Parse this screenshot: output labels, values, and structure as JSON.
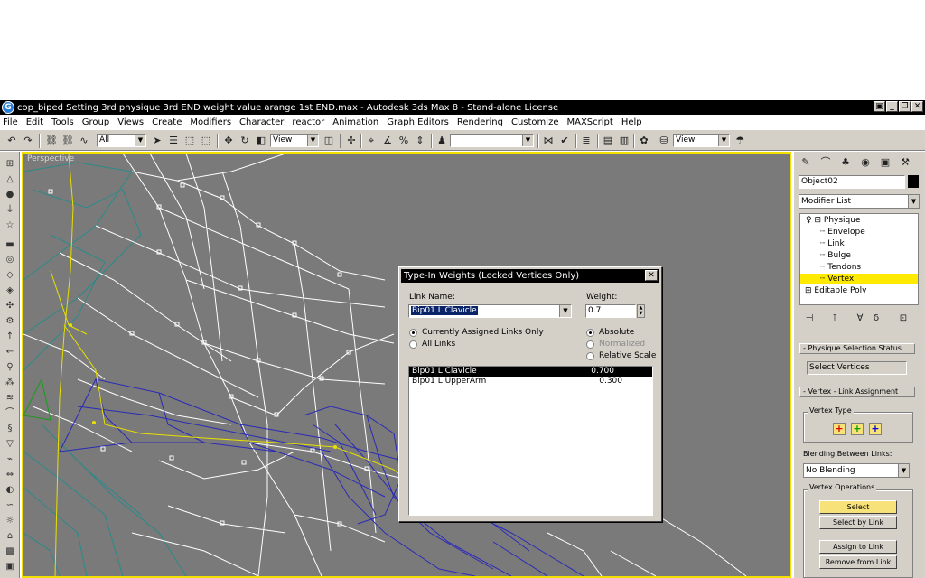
{
  "window": {
    "title": "cop_biped Setting 3rd physique 3rd END weight value arange 1st END.max - Autodesk 3ds Max 8  - Stand-alone License",
    "app_icon": "G",
    "buttons": [
      "▣",
      "_",
      "❐",
      "✕"
    ]
  },
  "menu": [
    "File",
    "Edit",
    "Tools",
    "Group",
    "Views",
    "Create",
    "Modifiers",
    "Character",
    "reactor",
    "Animation",
    "Graph Editors",
    "Rendering",
    "Customize",
    "MAXScript",
    "Help"
  ],
  "toolbar": {
    "selection_filter": "All",
    "ref_coord": "View",
    "named_selection": "",
    "render_view": "View"
  },
  "viewport": {
    "label": "Perspective",
    "colors": {
      "background": "#7a7a7a",
      "border": "#f2e000",
      "mesh": "#ffffff",
      "envelope": "#2a2ab8",
      "teal": "#2a8a8a",
      "bone": "#e8e000",
      "green": "#1a9a1a"
    }
  },
  "dialog": {
    "title": "Type-In Weights (Locked Vertices Only)",
    "link_name_label": "Link Name:",
    "link_name_value": "Bip01 L Clavicle",
    "weight_label": "Weight:",
    "weight_value": "0.7",
    "radio_current": "Currently Assigned Links Only",
    "radio_all": "All Links",
    "radio_absolute": "Absolute",
    "radio_normalized": "Normalized",
    "radio_relative": "Relative Scale",
    "links": [
      {
        "name": "Bip01 L Clavicle",
        "weight": "0.700"
      },
      {
        "name": "Bip01 L UpperArm",
        "weight": "0.300"
      }
    ]
  },
  "command_panel": {
    "object_name": "Object02",
    "modifier_list": "Modifier List",
    "stack": [
      "Physique",
      "Envelope",
      "Link",
      "Bulge",
      "Tendons",
      "Vertex",
      "Editable Poly"
    ],
    "rollout_status": "Physique Selection Status",
    "select_status": "Select Vertices",
    "rollout_link": "Vertex - Link Assignment",
    "vertex_type": "Vertex Type",
    "vertex_type_buttons": [
      "+",
      "+",
      "+"
    ],
    "blending_label": "Blending Between Links:",
    "blending_value": "No Blending",
    "vertex_ops": "Vertex Operations",
    "btn_select": "Select",
    "btn_select_by_link": "Select by Link",
    "btn_assign": "Assign to Link",
    "btn_remove": "Remove from Link"
  }
}
